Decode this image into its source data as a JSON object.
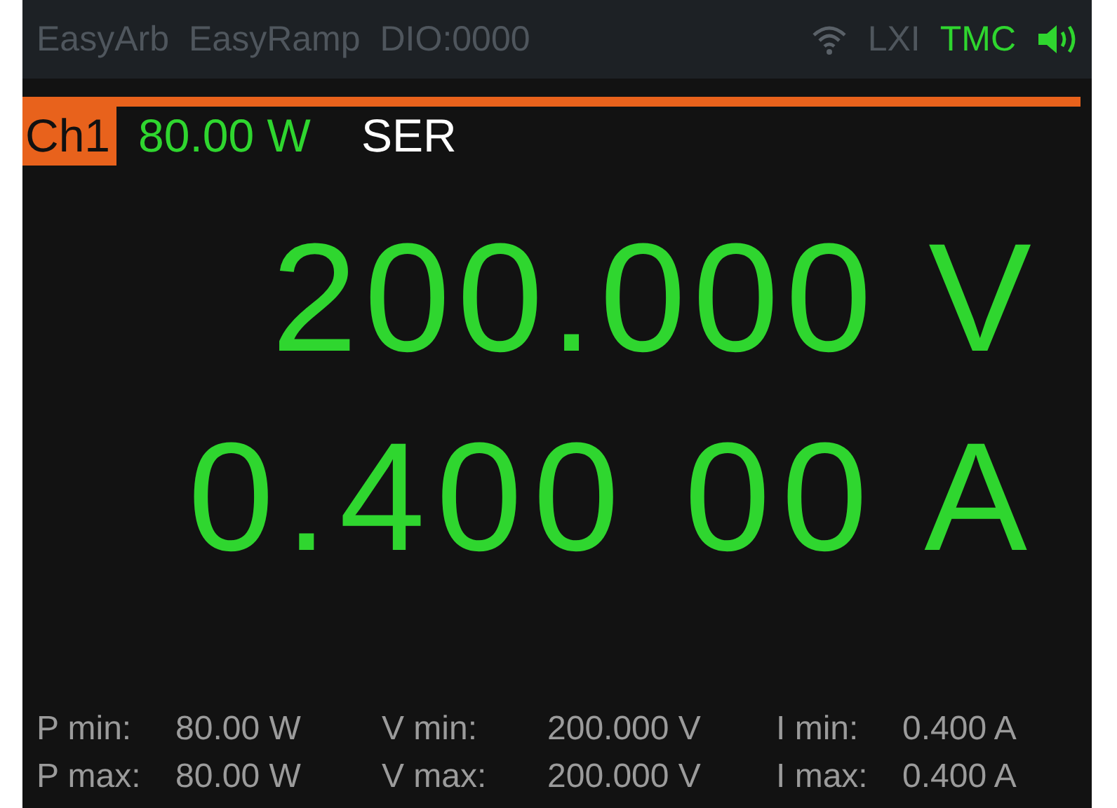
{
  "status_bar": {
    "apps": [
      "EasyArb",
      "EasyRamp",
      "DIO:0000"
    ],
    "interfaces": [
      {
        "label": "LXI",
        "active": false
      },
      {
        "label": "TMC",
        "active": true
      }
    ]
  },
  "channel": {
    "name": "Ch1",
    "power": "80.00 W",
    "mode": "SER"
  },
  "readings": [
    {
      "value": "200.000 V"
    },
    {
      "value": "0.400 00 A"
    }
  ],
  "limits": [
    {
      "cells": [
        {
          "label": "P min:",
          "value": "80.00 W"
        },
        {
          "label": "V min:",
          "value": "200.000 V"
        },
        {
          "label": "I min:",
          "value": "0.400 A"
        }
      ]
    },
    {
      "cells": [
        {
          "label": "P max:",
          "value": "80.00 W"
        },
        {
          "label": "V max:",
          "value": "200.000 V"
        },
        {
          "label": "I max:",
          "value": "0.400 A"
        }
      ]
    }
  ]
}
